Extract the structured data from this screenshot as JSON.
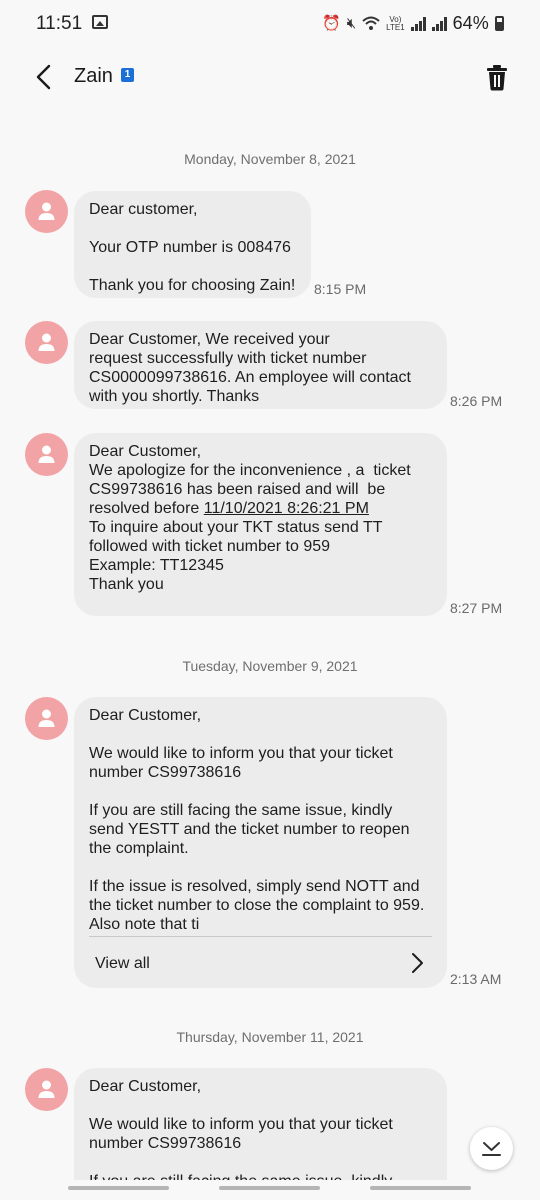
{
  "status_bar": {
    "time": "11:51",
    "volte_line1": "Vo)",
    "volte_line2": "LTE1",
    "battery_percent": "64%",
    "icons": [
      "gallery-icon",
      "alarm-icon",
      "mute-icon",
      "wifi-icon",
      "volte-icon",
      "signal-icon",
      "signal-icon",
      "battery-icon"
    ]
  },
  "header": {
    "contact_name": "Zain",
    "sim_badge": "1",
    "icons": [
      "back-arrow-icon",
      "trash-icon"
    ]
  },
  "conversation": {
    "date_1": "Monday, November 8, 2021",
    "date_2": "Tuesday, November 9, 2021",
    "date_3": "Thursday, November 11, 2021",
    "messages": [
      {
        "lines": [
          "Dear customer,",
          "",
          "Your OTP number is 008476",
          "",
          "Thank you for choosing Zain!"
        ],
        "time": "8:15 PM"
      },
      {
        "lines": [
          "Dear Customer, We received your",
          "request successfully with ticket number",
          "CS0000099738616. An employee will contact",
          "with you shortly. Thanks"
        ],
        "time": "8:26 PM"
      },
      {
        "lines": [
          "Dear Customer,",
          "We apologize for the inconvenience , a  ticket",
          "CS99738616 has been raised and will  be",
          "resolved before ",
          "To inquire about your TKT status send TT",
          "followed with ticket number to 959",
          "Example: TT12345",
          "Thank you"
        ],
        "link_text": "11/10/2021 8:26:21 PM",
        "time": "8:27 PM"
      },
      {
        "lines": [
          "Dear Customer,",
          "",
          "We would like to inform you that your ticket",
          "number CS99738616",
          "",
          "If you are still facing the same issue, kindly",
          "send YESTT and the ticket number to reopen",
          "the complaint.",
          "",
          "If the issue is resolved, simply send NOTT and",
          "the ticket number to close the complaint to 959.",
          "Also note that ti"
        ],
        "view_all_label": "View all",
        "time": "2:13 AM"
      },
      {
        "lines": [
          "Dear Customer,",
          "",
          "We would like to inform you that your ticket",
          "number CS99738616",
          "",
          "If you are still facing the same issue, kindly"
        ]
      }
    ]
  },
  "colors": {
    "background": "#f8f8f8",
    "bubble": "#ececec",
    "avatar": "#f2a3a5",
    "sim_badge": "#1b6fd6"
  }
}
